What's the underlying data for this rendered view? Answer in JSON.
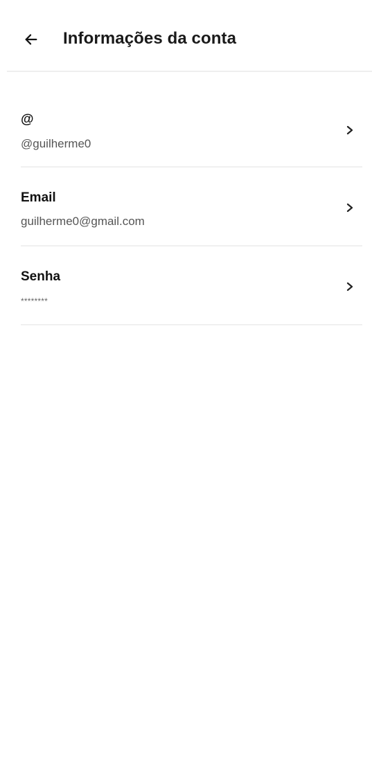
{
  "header": {
    "title": "Informações da conta",
    "back_icon": "arrow-left-icon"
  },
  "account": {
    "rows": [
      {
        "label": "@",
        "value": "@guilherme0",
        "icon": "chevron-right-icon"
      },
      {
        "label": "Email",
        "value": "guilherme0@gmail.com",
        "icon": "chevron-right-icon"
      },
      {
        "label": "Senha",
        "value": "********",
        "icon": "chevron-right-icon"
      }
    ]
  },
  "colors": {
    "text_primary": "#111111",
    "text_secondary": "#555555",
    "divider": "#eeeeee",
    "background": "#ffffff"
  }
}
